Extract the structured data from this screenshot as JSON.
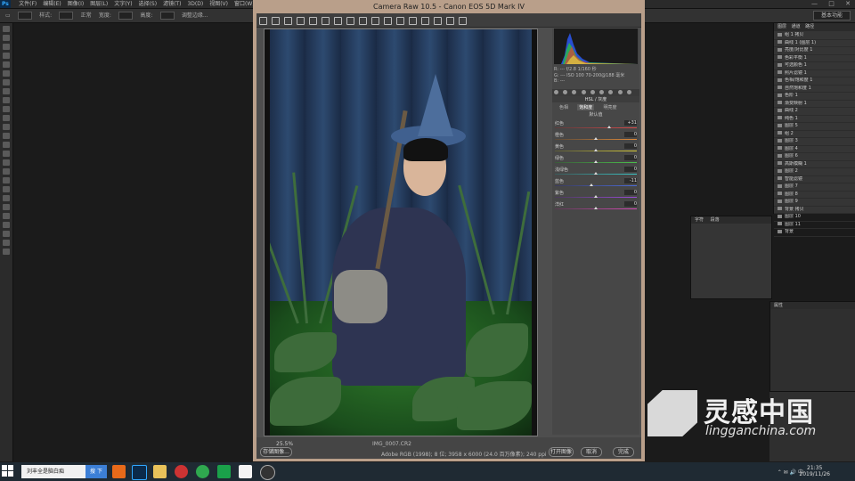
{
  "app": {
    "menus": [
      "文件(F)",
      "编辑(E)",
      "图像(I)",
      "图层(L)",
      "文字(Y)",
      "选择(S)",
      "滤镜(T)",
      "3D(D)",
      "视图(V)",
      "窗口(W)",
      "帮助(H)"
    ],
    "logo": "Ps",
    "window_controls": [
      "—",
      "□",
      "✕"
    ],
    "workspace_select": "基本功能",
    "options_bar": [
      "样式:",
      "正常",
      "宽度:",
      "高度:",
      "调整边缘..."
    ]
  },
  "camera_raw": {
    "title": "Camera Raw 10.5  -  Canon EOS 5D Mark IV",
    "zoom": "25.5%",
    "filename": "IMG_0007.CR2",
    "info": "Adobe RGB (1998); 8 位; 3958 x 6000 (24.0 百万像素); 240 ppi",
    "buttons": {
      "save": "存储图像...",
      "open": "打开图像",
      "cancel": "取消",
      "done": "完成"
    },
    "histogram_info": [
      "R: --- f/2.8 1/160 秒",
      "G: --- ISO 100 70-200@188 毫米",
      "B: ---"
    ],
    "panel_title": "HSL / 灰度",
    "hsl_tabs": [
      "色相",
      "饱和度",
      "明亮度"
    ],
    "active_tab": "饱和度",
    "sub_label": "默认值",
    "sliders": [
      {
        "label": "红色",
        "value": "+31",
        "pos": 0.66,
        "colors": [
          "#5a3b3b",
          "#d94b4b"
        ]
      },
      {
        "label": "橙色",
        "value": "0",
        "pos": 0.5,
        "colors": [
          "#5a4a3a",
          "#e08a3a"
        ]
      },
      {
        "label": "黄色",
        "value": "0",
        "pos": 0.5,
        "colors": [
          "#5a5a3a",
          "#d8cc3a"
        ]
      },
      {
        "label": "绿色",
        "value": "0",
        "pos": 0.5,
        "colors": [
          "#3b5a3b",
          "#4bc04b"
        ]
      },
      {
        "label": "浅绿色",
        "value": "0",
        "pos": 0.5,
        "colors": [
          "#3b5a5a",
          "#3ac6c6"
        ]
      },
      {
        "label": "蓝色",
        "value": "-11",
        "pos": 0.45,
        "colors": [
          "#3b3b5a",
          "#4b6bd9"
        ]
      },
      {
        "label": "紫色",
        "value": "0",
        "pos": 0.5,
        "colors": [
          "#4a3b5a",
          "#9a4bd9"
        ]
      },
      {
        "label": "洋红",
        "value": "0",
        "pos": 0.5,
        "colors": [
          "#5a3b52",
          "#d94bb8"
        ]
      }
    ]
  },
  "layers_panel": {
    "tabs": [
      "图层",
      "通道",
      "路径"
    ],
    "rows": [
      "组 1 拷贝",
      "曲线 1 (图层 1)",
      "亮度/对比度 1",
      "色彩平衡 1",
      "可选颜色 1",
      "照片滤镜 1",
      "色相/饱和度 1",
      "自然饱和度 1",
      "色阶 1",
      "渐变映射 1",
      "曲线 2",
      "纯色 1",
      "图层 5",
      "组 2",
      "图层 3",
      "图层 4",
      "图层 6",
      "高斯模糊 1",
      "图层 2",
      "智能滤镜",
      "图层 7",
      "图层 8",
      "图层 9",
      "背景 拷贝",
      "图层 10",
      "图层 11",
      "背景"
    ]
  },
  "char_panel": {
    "tabs": [
      "字符",
      "段落"
    ]
  },
  "props_panel": {
    "title": "属性"
  },
  "watermark": {
    "cn": "灵感中国",
    "en": "lingganchina.com"
  },
  "taskbar": {
    "search": "刘丰全是脑白痴",
    "search_btn": "搜 下",
    "tray": "⌃ ✉ 🔊 中",
    "time": "21:35",
    "date": "2019/11/26"
  }
}
